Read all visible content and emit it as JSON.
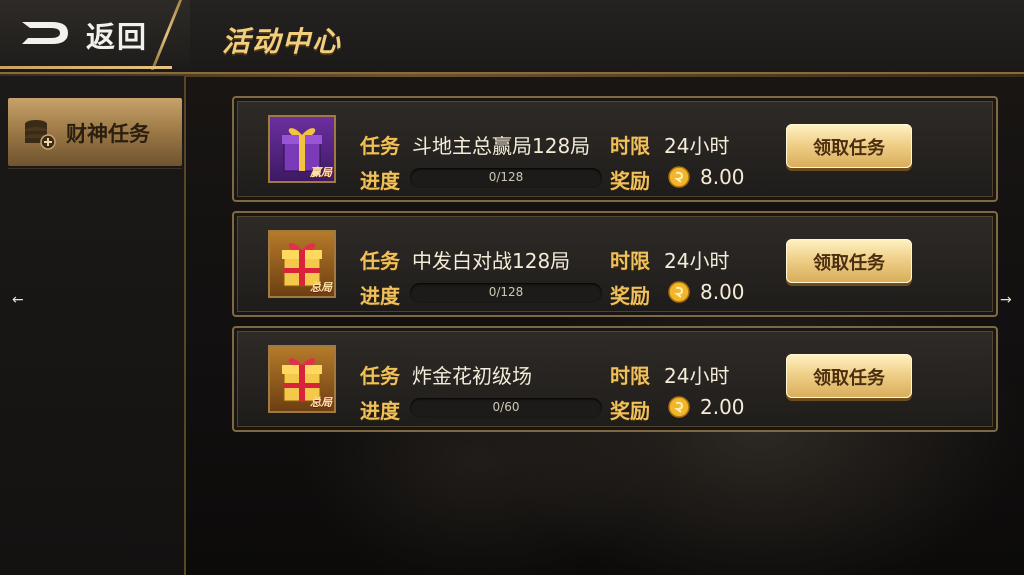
{
  "header": {
    "back_label": "返回",
    "title": "活动中心"
  },
  "sidebar": {
    "items": [
      {
        "label": "财神任务",
        "icon": "coin-stack-icon",
        "selected": true
      }
    ]
  },
  "labels": {
    "task": "任务",
    "time_limit": "时限",
    "progress": "进度",
    "reward": "奖励",
    "accept_button": "领取任务"
  },
  "tasks": [
    {
      "name": "斗地主总赢局128局",
      "time_limit": "24小时",
      "progress_text": "0/128",
      "progress_fraction": 0,
      "reward": "8.00",
      "badge": "赢局",
      "gift_color": "purple"
    },
    {
      "name": "中发白对战128局",
      "time_limit": "24小时",
      "progress_text": "0/128",
      "progress_fraction": 0,
      "reward": "8.00",
      "badge": "总局",
      "gift_color": "red-gold"
    },
    {
      "name": "炸金花初级场",
      "time_limit": "24小时",
      "progress_text": "0/60",
      "progress_fraction": 0,
      "reward": "2.00",
      "badge": "总局",
      "gift_color": "red-gold"
    }
  ],
  "nav": {
    "left_arrow": "←",
    "right_arrow": "→"
  },
  "colors": {
    "accent_gold": "#f0c05a",
    "button_gold": "#f0d089",
    "card_border": "#7f6844"
  }
}
